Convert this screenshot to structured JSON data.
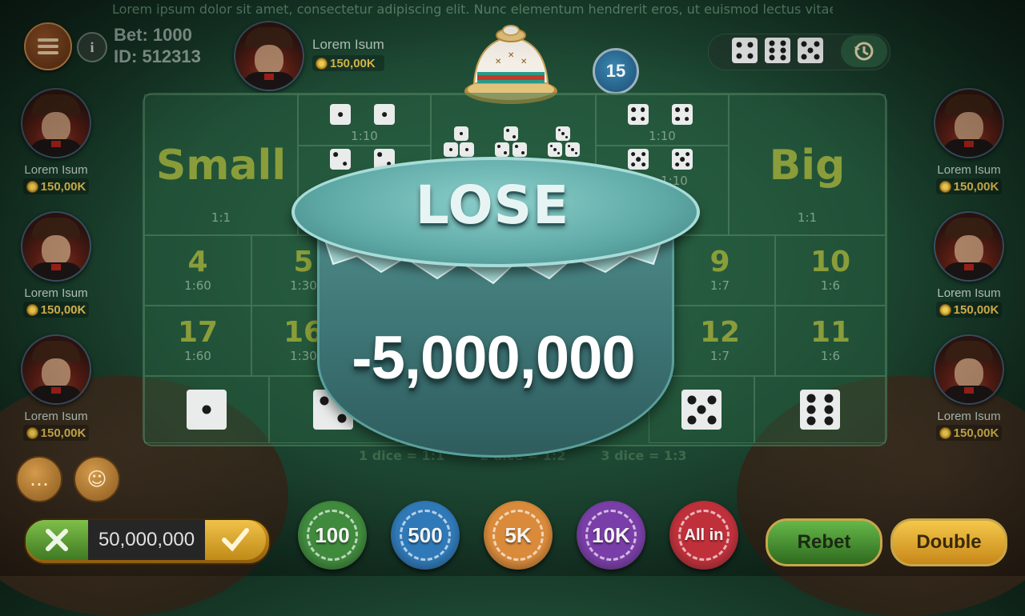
{
  "marquee": "Lorem ipsum dolor sit amet, consectetur adipiscing elit. Nunc elementum hendrerit eros, ut euismod lectus vitae",
  "player": {
    "bet_label": "Bet: 1000",
    "id_label": "ID: 512313"
  },
  "top_player": {
    "name": "Lorem Isum",
    "coins": "150,00K"
  },
  "left_players": [
    {
      "name": "Lorem Isum",
      "coins": "150,00K"
    },
    {
      "name": "Lorem Isum",
      "coins": "150,00K"
    },
    {
      "name": "Lorem Isum",
      "coins": "150,00K"
    }
  ],
  "right_players": [
    {
      "name": "Lorem Isum",
      "coins": "150,00K"
    },
    {
      "name": "Lorem Isum",
      "coins": "150,00K"
    },
    {
      "name": "Lorem Isum",
      "coins": "150,00K"
    }
  ],
  "timer": "15",
  "history_dice": [
    4,
    6,
    5
  ],
  "board": {
    "small_label": "Small",
    "big_label": "Big",
    "small_odds": "1:1",
    "big_odds": "1:1",
    "triple_odds_left_top": "1:10",
    "triple_odds_right_top": "1:10",
    "triple_odds_right_mid": "1:10",
    "totals_row1": [
      {
        "num": "4",
        "odds": "1:60"
      },
      {
        "num": "5",
        "odds": "1:30"
      },
      {
        "num": "9",
        "odds": "1:7"
      },
      {
        "num": "10",
        "odds": "1:6"
      }
    ],
    "totals_row2": [
      {
        "num": "17",
        "odds": "1:60"
      },
      {
        "num": "16",
        "odds": "1:30"
      },
      {
        "num": "12",
        "odds": "1:7"
      },
      {
        "num": "11",
        "odds": "1:6"
      }
    ],
    "single_dice": [
      1,
      2,
      5,
      6
    ],
    "notes": [
      "1 dice = 1:1",
      "2 dice = 1:2",
      "3 dice = 1:3"
    ]
  },
  "result": {
    "title": "LOSE",
    "amount": "-5,000,000"
  },
  "bet_input": {
    "value": "50,000,000"
  },
  "chips": [
    {
      "label": "100",
      "color": "#3f8a3c"
    },
    {
      "label": "500",
      "color": "#2f79b8"
    },
    {
      "label": "5K",
      "color": "#d98a3a"
    },
    {
      "label": "10K",
      "color": "#7a3ea8"
    },
    {
      "label": "All in",
      "color": "#c0303a"
    }
  ],
  "buttons": {
    "rebet": "Rebet",
    "double": "Double"
  },
  "colors": {
    "accent_gold": "#d8b84c",
    "board_text": "#8a9d3a",
    "modal_teal": "#5ea9a6"
  }
}
